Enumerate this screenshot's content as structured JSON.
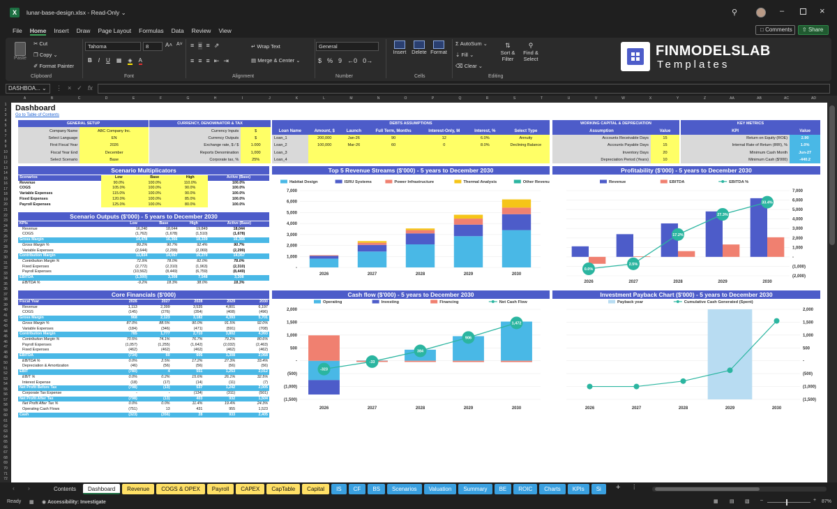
{
  "title": {
    "file": "lunar-base-design.xlsx",
    "sep": "-",
    "mode": "Read-Only"
  },
  "menu": [
    "File",
    "Home",
    "Insert",
    "Draw",
    "Page Layout",
    "Formulas",
    "Data",
    "Review",
    "View"
  ],
  "comments_label": "Comments",
  "share_label": "Share",
  "ribbon": {
    "paste": "Paste",
    "cut": "Cut",
    "copy": "Copy",
    "format_painter": "Format Painter",
    "clipboard": "Clipboard",
    "font_name": "Tahoma",
    "font_size": "8",
    "font": "Font",
    "wrap": "Wrap Text",
    "merge": "Merge & Center",
    "alignment": "Alignment",
    "numfmt": "General",
    "number": "Number",
    "insert": "Insert",
    "delete": "Delete",
    "format": "Format",
    "cells": "Cells",
    "autosum": "AutoSum",
    "fill": "Fill",
    "clear": "Clear",
    "sort": "Sort &",
    "filter": "Filter",
    "find": "Find &",
    "select": "Select",
    "editing": "Editing",
    "brand1": "FINMODELSLAB",
    "brand2": "Templates"
  },
  "namebox": "DASHBOA...",
  "fx": "fx",
  "columns": [
    "A",
    "B",
    "C",
    "D",
    "E",
    "F",
    "G",
    "H",
    "I",
    "J",
    "K",
    "L",
    "M",
    "N",
    "O",
    "P",
    "Q",
    "R",
    "S",
    "T",
    "U",
    "V",
    "W",
    "X",
    "Y",
    "Z",
    "AA",
    "AB",
    "AC",
    "AD"
  ],
  "sheet": {
    "title": "Dashboard",
    "toc": "Go to Table of Contents",
    "general": {
      "header": "GENERAL SETUP",
      "rows": [
        [
          "Company Name",
          "ABC Company Inc."
        ],
        [
          "Select Language",
          "EN"
        ],
        [
          "First Fiscal Year",
          "2026"
        ],
        [
          "Fiscal Year End",
          "December"
        ],
        [
          "Select Scenario",
          "Base"
        ]
      ]
    },
    "currency": {
      "header": "CURRENCY, DENOMINATOR & TAX",
      "rows": [
        [
          "Currency Inputs",
          "$"
        ],
        [
          "Currency Outputs",
          "$"
        ],
        [
          "Exchange rate, $ / $",
          "1.000"
        ],
        [
          "Reports Denomination",
          "1,000"
        ],
        [
          "Corporate tax, %",
          "25%"
        ]
      ]
    },
    "debts": {
      "header": "DEBTS ASSUMPTIONS",
      "cols": [
        "Loan Name",
        "Amount, $",
        "Launch",
        "Full Term, Months",
        "Interest-Only, M",
        "Interest, %",
        "Select Type"
      ],
      "rows": [
        [
          "Loan_1",
          "200,000",
          "Jan-26",
          "90",
          "12",
          "6.0%",
          "Annuity"
        ],
        [
          "Loan_2",
          "100,000",
          "Mar-26",
          "60",
          "0",
          "8.0%",
          "Declining Balance"
        ],
        [
          "Loan_3",
          "",
          "",
          "",
          "",
          "",
          ""
        ],
        [
          "Loan_4",
          "",
          "",
          "",
          "",
          "",
          ""
        ]
      ]
    },
    "wc": {
      "header": "WORKING CAPITAL & DEPRECIATION",
      "cols": [
        "Assumption",
        "Value"
      ],
      "rows": [
        [
          "Accounts Receivable Days",
          "15"
        ],
        [
          "Accounts Payable Days",
          "15"
        ],
        [
          "Inventory Days",
          "20"
        ],
        [
          "Depreciation Period (Years)",
          "10"
        ]
      ]
    },
    "kpi": {
      "header": "KEY METRICS",
      "cols": [
        "KPI",
        "Value"
      ],
      "rows": [
        [
          "Return on Equity (ROE)",
          "2.90"
        ],
        [
          "Internal Rate of Return (IRR), %",
          "1.0%"
        ],
        [
          "Minimum Cash Month",
          "Jun-27"
        ],
        [
          "Minimum Cash ($'000)",
          "-440.2"
        ]
      ]
    },
    "multipliers": {
      "title": "Scenario Multiplicators",
      "cols": [
        "Scenarios",
        "Low",
        "Base",
        "High",
        "Active (Base)"
      ],
      "rows": [
        [
          "Revenue",
          "90.0%",
          "100.0%",
          "110.0%",
          "100.0%"
        ],
        [
          "COGS",
          "105.0%",
          "100.0%",
          "90.0%",
          "100.0%"
        ],
        [
          "Variable Expenses",
          "115.0%",
          "100.0%",
          "90.0%",
          "100.0%"
        ],
        [
          "Fixed Expenses",
          "120.0%",
          "100.0%",
          "85.0%",
          "100.0%"
        ],
        [
          "Payroll Expenses",
          "125.0%",
          "100.0%",
          "80.0%",
          "100.0%"
        ]
      ]
    },
    "outputs": {
      "title": "Scenario Outputs ($'000) - 5 years to December 2030",
      "cols": [
        "KPIs",
        "Low",
        "Base",
        "High",
        "Active (Base)"
      ],
      "rows": [
        {
          "c": [
            "Revenue",
            "16,240",
            "18,044",
            "19,849",
            "18,044"
          ],
          "t": "nm"
        },
        {
          "c": [
            "COGS",
            "(1,762)",
            "(1,678)",
            "(1,510)",
            "(1,678)"
          ],
          "t": "nm"
        },
        {
          "c": [
            "Gross Margin",
            "14,478",
            "16,366",
            "18,339",
            "16,366"
          ],
          "t": "hl"
        },
        {
          "c": [
            "Gross Margin %",
            "89.2%",
            "90.7%",
            "92.4%",
            "90.7%"
          ],
          "t": "it"
        },
        {
          "c": [
            "Variable Expenses",
            "(2,644)",
            "(2,299)",
            "(2,069)",
            "(2,299)"
          ],
          "t": "nm"
        },
        {
          "c": [
            "Contribution Margin",
            "11,834",
            "14,067",
            "16,270",
            "14,067"
          ],
          "t": "hl"
        },
        {
          "c": [
            "Contribution Margin %",
            "72.9%",
            "78.0%",
            "82.0%",
            "78.0%"
          ],
          "t": "it"
        },
        {
          "c": [
            "Fixed Expenses",
            "(2,772)",
            "(2,310)",
            "(1,963)",
            "(2,310)"
          ],
          "t": "nm"
        },
        {
          "c": [
            "Payroll Expenses",
            "(10,562)",
            "(8,449)",
            "(6,759)",
            "(8,449)"
          ],
          "t": "nm"
        },
        {
          "c": [
            "EBITDA",
            "(1,500)",
            "3,308",
            "7,548",
            "3,308"
          ],
          "t": "hl"
        },
        {
          "c": [
            "EBITDA %",
            "-9.2%",
            "18.3%",
            "38.0%",
            "18.3%"
          ],
          "t": "it"
        }
      ]
    },
    "core": {
      "title": "Core Financials ($'000)",
      "cols": [
        "Fiscal Year",
        "2026",
        "2027",
        "2028",
        "2029",
        "2030"
      ],
      "rows": [
        {
          "c": [
            "Revenue",
            "1,113",
            "2,399",
            "3,535",
            "4,801",
            "6,197"
          ],
          "t": "nm"
        },
        {
          "c": [
            "COGS",
            "(145)",
            "(276)",
            "(354)",
            "(408)",
            "(496)"
          ],
          "t": "nm"
        },
        {
          "c": [
            "Gross Margin",
            "968",
            "2,123",
            "3,182",
            "4,393",
            "5,701"
          ],
          "t": "hl"
        },
        {
          "c": [
            "Gross Margin %",
            "87.0%",
            "88.5%",
            "90.0%",
            "91.5%",
            "92.0%"
          ],
          "t": "it"
        },
        {
          "c": [
            "Variable Expenses",
            "(184)",
            "(346)",
            "(471)",
            "(591)",
            "(708)"
          ],
          "t": "nm"
        },
        {
          "c": [
            "Contribution Margin",
            "785",
            "1,777",
            "2,710",
            "3,802",
            "4,993"
          ],
          "t": "hl"
        },
        {
          "c": [
            "Contribution Margin %",
            "70.5%",
            "74.1%",
            "76.7%",
            "79.2%",
            "80.6%"
          ],
          "t": "it"
        },
        {
          "c": [
            "Payroll Expenses",
            "(1,057)",
            "(1,255)",
            "(1,642)",
            "(2,032)",
            "(2,463)"
          ],
          "t": "nm"
        },
        {
          "c": [
            "Fixed Expenses",
            "(462)",
            "(462)",
            "(462)",
            "(462)",
            "(462)"
          ],
          "t": "nm"
        },
        {
          "c": [
            "EBITDA",
            "(734)",
            "60",
            "606",
            "1,308",
            "2,068"
          ],
          "t": "hl"
        },
        {
          "c": [
            "EBITDA %",
            "0.0%",
            "2.5%",
            "17.2%",
            "27.3%",
            "33.4%"
          ],
          "t": "it"
        },
        {
          "c": [
            "Depreciation & Amortization",
            "(46)",
            "(56)",
            "(56)",
            "(56)",
            "(56)"
          ],
          "t": "nm"
        },
        {
          "c": [
            "EBIT",
            "(780)",
            "4",
            "551",
            "1,253",
            "2,012"
          ],
          "t": "hl"
        },
        {
          "c": [
            "EBIT %",
            "0.0%",
            "0.2%",
            "15.6%",
            "26.1%",
            "32.5%"
          ],
          "t": "it"
        },
        {
          "c": [
            "Interest Expense",
            "(18)",
            "(17)",
            "(14)",
            "(11)",
            "(7)"
          ],
          "t": "nm"
        },
        {
          "c": [
            "Net Profit Before Tax",
            "(798)",
            "(13)",
            "537",
            "1,242",
            "2,005"
          ],
          "t": "hl"
        },
        {
          "c": [
            "Corporate Tax Expense",
            "-",
            "-",
            "(134)",
            "(311)",
            "(501)"
          ],
          "t": "nm"
        },
        {
          "c": [
            "Net Profit After Tax",
            "(798)",
            "(13)",
            "403",
            "932",
            "1,504"
          ],
          "t": "hl"
        },
        {
          "c": [
            "Net Profit After Tax %",
            "0.0%",
            "0.0%",
            "11.4%",
            "19.4%",
            "24.3%"
          ],
          "t": "it"
        },
        {
          "c": [
            "Operating Cash Flows",
            "(751)",
            "13",
            "431",
            "955",
            "1,523"
          ],
          "t": "nm"
        },
        {
          "c": [
            "Cash",
            "(323)",
            "(356)",
            "28",
            "933",
            "2,405"
          ],
          "t": "hl"
        }
      ]
    },
    "charts": {
      "rev_title": "Top 5 Revenue Streams ($'000) - 5 years to December 2030",
      "prof_title": "Profitability ($'000) - 5 years to December 2030",
      "cf_title": "Cash flow ($'000) - 5 years to December 2030",
      "pay_title": "Investment Payback Chart ($'000) - 5 years to December 2030"
    }
  },
  "chart_data": [
    {
      "type": "bar",
      "stacked": true,
      "title": "Top 5 Revenue Streams ($'000) - 5 years to December 2030",
      "categories": [
        "2026",
        "2027",
        "2028",
        "2029",
        "2030"
      ],
      "ylim": [
        0,
        7000
      ],
      "legend": "top",
      "yticks": [
        "-",
        "1,000",
        "2,000",
        "3,000",
        "4,000",
        "5,000",
        "6,000",
        "7,000"
      ],
      "series": [
        {
          "name": "Habitat Design",
          "color": "#49b8e6",
          "values": [
            800,
            1450,
            2100,
            2850,
            3400
          ]
        },
        {
          "name": "ISRU Systems",
          "color": "#4d5cc9",
          "values": [
            250,
            600,
            1000,
            1050,
            1450
          ]
        },
        {
          "name": "Power Infrastructure",
          "color": "#f08070",
          "values": [
            60,
            200,
            300,
            550,
            600
          ]
        },
        {
          "name": "Thermal Analysis",
          "color": "#f5c518",
          "values": [
            3,
            150,
            150,
            350,
            750
          ]
        },
        {
          "name": "Other Revenue",
          "color": "#2bb5a0",
          "values": [
            0,
            0,
            0,
            0,
            0
          ]
        }
      ]
    },
    {
      "type": "bar+line",
      "title": "Profitability ($'000) - 5 years to December 2030",
      "categories": [
        "2026",
        "2027",
        "2028",
        "2029",
        "2030"
      ],
      "ylim": [
        -2000,
        7000
      ],
      "legend": "top",
      "yticks": [
        "(2,000)",
        "(1,000)",
        "-",
        "1,000",
        "2,000",
        "3,000",
        "4,000",
        "5,000",
        "6,000",
        "7,000"
      ],
      "series": [
        {
          "name": "Revenue",
          "color": "#4d5cc9",
          "values": [
            1113,
            2399,
            3535,
            4801,
            6197
          ]
        },
        {
          "name": "EBITDA",
          "color": "#f08070",
          "values": [
            -734,
            60,
            606,
            1308,
            2068
          ]
        },
        {
          "name": "EBITDA %",
          "color": "#2bb5a0",
          "values": [
            0.0,
            2.5,
            17.2,
            27.3,
            33.4
          ],
          "labels": [
            "0.0%",
            "2.5%",
            "17.2%",
            "27.3%",
            "33.4%"
          ]
        }
      ]
    },
    {
      "type": "bar+line",
      "title": "Cash flow ($'000) - 5 years to December 2030",
      "categories": [
        "2026",
        "2027",
        "2028",
        "2029",
        "2030"
      ],
      "ylim": [
        -1500,
        2000
      ],
      "legend": "top",
      "yticks": [
        "(1,500)",
        "(1,000)",
        "(500)",
        "-",
        "500",
        "1,000",
        "1,500",
        "2,000"
      ],
      "series": [
        {
          "name": "Operating",
          "color": "#49b8e6",
          "values": [
            -751,
            13,
            431,
            955,
            1523
          ]
        },
        {
          "name": "Investing",
          "color": "#4d5cc9",
          "values": [
            -560,
            0,
            0,
            0,
            0
          ]
        },
        {
          "name": "Financing",
          "color": "#f08070",
          "values": [
            988,
            -46,
            -47,
            -50,
            -51
          ]
        },
        {
          "name": "Net Cash Flow",
          "color": "#2bb5a0",
          "values": [
            -323,
            -33,
            384,
            906,
            1472
          ],
          "labels": [
            "-323",
            "-33",
            "384",
            "906",
            "1,472"
          ]
        }
      ]
    },
    {
      "type": "bar+line",
      "title": "Investment Payback Chart ($'000) - 5 years to December 2030",
      "categories": [
        "2026",
        "2027",
        "2028",
        "2029",
        "2030"
      ],
      "ylim": [
        -1500,
        2000
      ],
      "legend": "top",
      "yticks": [
        "(1,500)",
        "(1,000)",
        "(500)",
        "-",
        "500",
        "1,000",
        "1,500",
        "2,000"
      ],
      "series": [
        {
          "name": "Payback year",
          "color": "#b8dcf2",
          "values": [
            0,
            0,
            0,
            1,
            0
          ]
        },
        {
          "name": "Cumulative Cash Generated (Spent)",
          "color": "#2bb5a0",
          "values": [
            -1000,
            -1000,
            -790,
            -370,
            1550
          ]
        }
      ]
    }
  ],
  "sheet_tabs": [
    {
      "n": "Contents",
      "s": "plain"
    },
    {
      "n": "Dashboard",
      "s": "active"
    },
    {
      "n": "Revenue",
      "s": "y"
    },
    {
      "n": "COGS & OPEX",
      "s": "y"
    },
    {
      "n": "Payroll",
      "s": "y"
    },
    {
      "n": "CAPEX",
      "s": "y"
    },
    {
      "n": "CapTable",
      "s": "y"
    },
    {
      "n": "Capital",
      "s": "y"
    },
    {
      "n": "IS",
      "s": "b"
    },
    {
      "n": "CF",
      "s": "b"
    },
    {
      "n": "BS",
      "s": "b"
    },
    {
      "n": "Scenarios",
      "s": "b"
    },
    {
      "n": "Valuation",
      "s": "b"
    },
    {
      "n": "Summary",
      "s": "b"
    },
    {
      "n": "BE",
      "s": "b"
    },
    {
      "n": "ROIC",
      "s": "b"
    },
    {
      "n": "Charts",
      "s": "b"
    },
    {
      "n": "KPIs",
      "s": "b"
    },
    {
      "n": "Si",
      "s": "b"
    }
  ],
  "status": {
    "ready": "Ready",
    "access": "Accessibility: Investigate",
    "zoom": "87%"
  }
}
